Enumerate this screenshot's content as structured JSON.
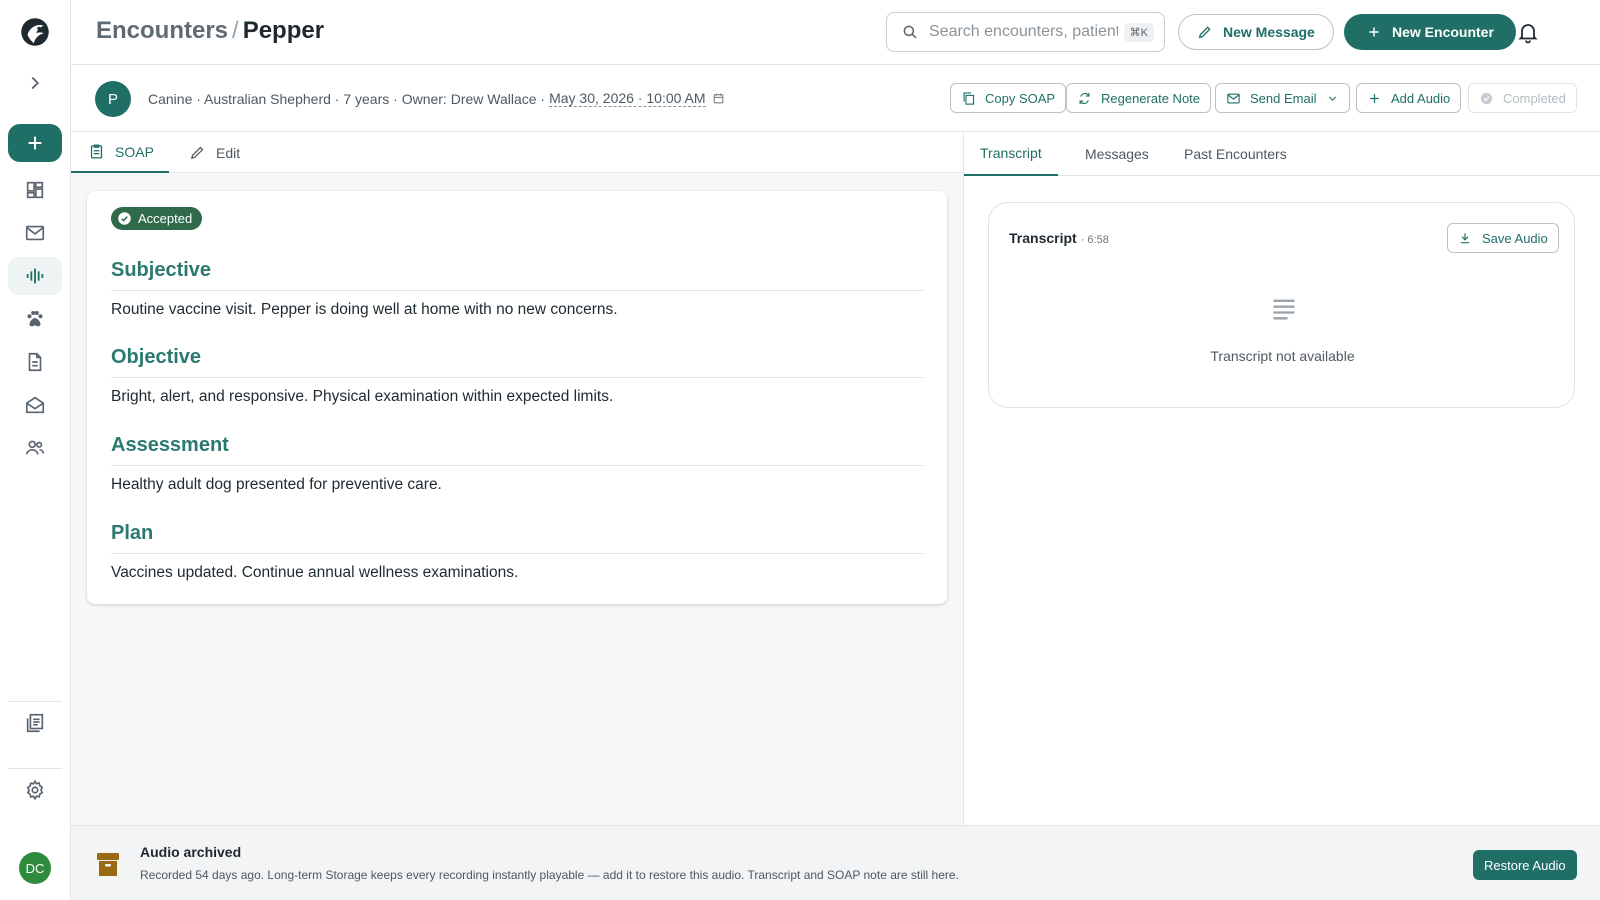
{
  "breadcrumb": {
    "parent": "Encounters",
    "separator": "/",
    "current": "Pepper"
  },
  "search": {
    "placeholder": "Search encounters, patients…",
    "shortcut": "⌘K"
  },
  "header": {
    "new_message": "New Message",
    "new_encounter": "New Encounter"
  },
  "patient": {
    "initial": "P",
    "summary": "Canine · Australian Shepherd · 7 years · Owner: Drew Wallace ·",
    "datetime": "May 30, 2026 · 10:00 AM"
  },
  "actions": {
    "copy_soap": "Copy SOAP",
    "regenerate": "Regenerate Note",
    "send_email": "Send Email",
    "add_audio": "Add Audio",
    "completed": "Completed"
  },
  "left_tabs": {
    "soap": "SOAP",
    "edit": "Edit"
  },
  "soap": {
    "status": "Accepted",
    "sections": [
      {
        "title": "Subjective",
        "text": "Routine vaccine visit. Pepper is doing well at home with no new concerns."
      },
      {
        "title": "Objective",
        "text": "Bright, alert, and responsive. Physical examination within expected limits."
      },
      {
        "title": "Assessment",
        "text": "Healthy adult dog presented for preventive care."
      },
      {
        "title": "Plan",
        "text": "Vaccines updated. Continue annual wellness examinations."
      }
    ]
  },
  "right_tabs": {
    "transcript": "Transcript",
    "messages": "Messages",
    "past": "Past Encounters"
  },
  "transcript": {
    "title": "Transcript",
    "duration": "· 6:58",
    "save_audio": "Save Audio",
    "empty": "Transcript not available"
  },
  "footer": {
    "title": "Audio archived",
    "text": "Recorded 54 days ago. Long-term Storage keeps every recording instantly playable — add it to restore this audio. Transcript and SOAP note are still here.",
    "restore": "Restore Audio"
  },
  "user": {
    "initials": "DC"
  },
  "colors": {
    "primary": "#1f6f66",
    "heading": "#2a7a6f",
    "accepted": "#2f6b4b",
    "archive": "#9a6a12",
    "avatar": "#2e8b3c"
  }
}
